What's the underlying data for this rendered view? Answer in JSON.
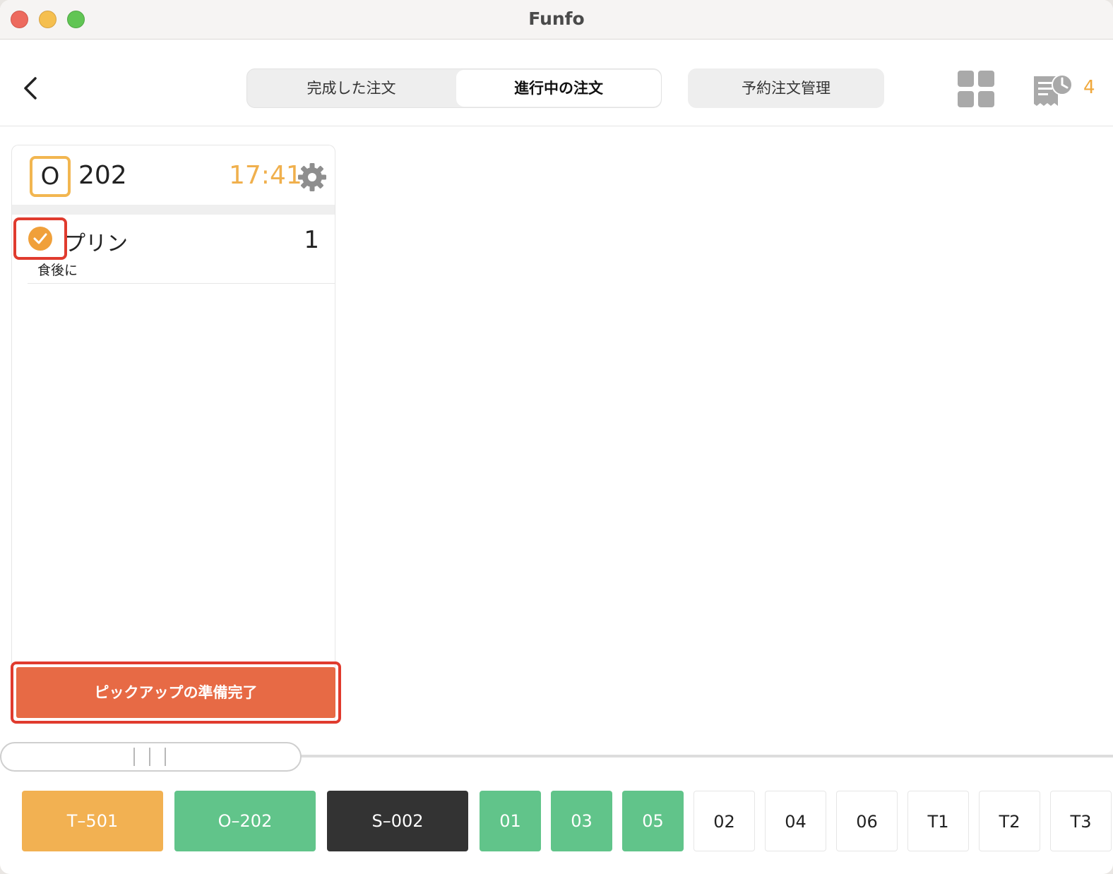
{
  "window": {
    "title": "Funfo"
  },
  "header": {
    "back_icon": "chevron-left-icon",
    "tabs": [
      {
        "label": "完成した注文",
        "active": false
      },
      {
        "label": "進行中の注文",
        "active": true
      }
    ],
    "reservation_button": "予約注文管理",
    "grid_icon": "grid-icon",
    "receipt_icon": "receipt-clock-icon",
    "receipt_count": "4"
  },
  "order_card": {
    "type_letter": "O",
    "number": "202",
    "time": "17:41",
    "items": [
      {
        "name": "プリン",
        "quantity": "1",
        "note": "食後に",
        "checked": true
      }
    ],
    "ready_button": "ピックアップの準備完了"
  },
  "order_tabs": [
    {
      "label": "T–501",
      "status": "orange"
    },
    {
      "label": "O–202",
      "status": "green"
    },
    {
      "label": "S–002",
      "status": "dark"
    },
    {
      "label": "01",
      "status": "green"
    },
    {
      "label": "03",
      "status": "green"
    },
    {
      "label": "05",
      "status": "green"
    },
    {
      "label": "02",
      "status": "empty"
    },
    {
      "label": "04",
      "status": "empty"
    },
    {
      "label": "06",
      "status": "empty"
    },
    {
      "label": "T1",
      "status": "empty"
    },
    {
      "label": "T2",
      "status": "empty"
    },
    {
      "label": "T3",
      "status": "empty"
    }
  ],
  "colors": {
    "accent_orange": "#f2b152",
    "green": "#61c48a",
    "dark": "#333333",
    "ready_button": "#e76a45",
    "highlight": "#e03b2e"
  }
}
